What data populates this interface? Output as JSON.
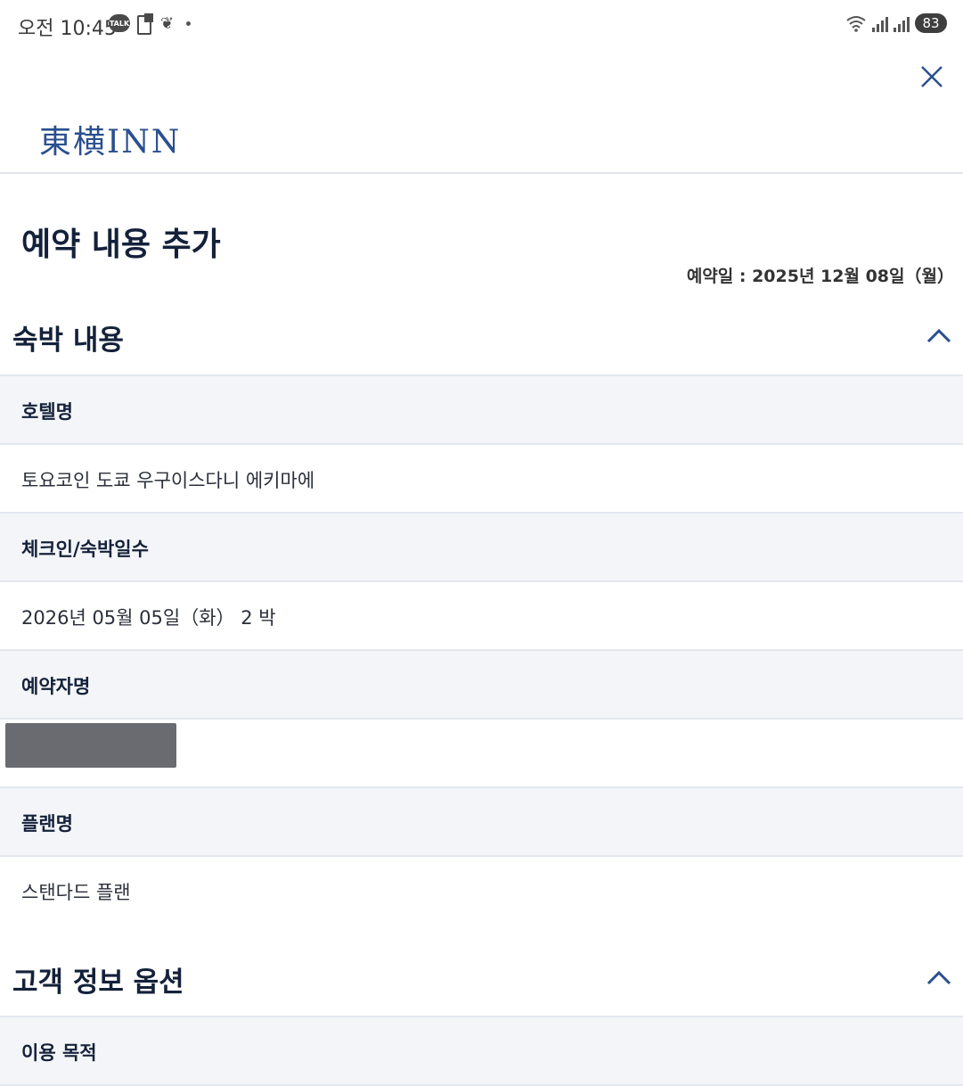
{
  "status_bar": {
    "time": "오전 10:45",
    "talk_badge": "TALK",
    "battery": "83",
    "icons": [
      "kakaotalk-icon",
      "document-icon",
      "butterfly-icon",
      "wifi-icon",
      "signal-icon",
      "battery-icon"
    ]
  },
  "header": {
    "logo": "東横INN",
    "close_icon": "close-icon"
  },
  "page": {
    "title": "예약 내용 추가",
    "booking_date": "예약일 : 2025년 12월 08일（월）"
  },
  "stay_section": {
    "title": "숙박 내용",
    "rows": [
      {
        "label": "호텔명",
        "value": "토요코인 도쿄 우구이스다니 에키마에"
      },
      {
        "label": "체크인/숙박일수",
        "value": "2026년 05월 05일（화） 2 박"
      },
      {
        "label": "예약자명",
        "value": ""
      },
      {
        "label": "플랜명",
        "value": "스탠다드 플랜"
      }
    ]
  },
  "customer_section": {
    "title": "고객 정보 옵션",
    "rows": [
      {
        "label": "이용 목적"
      }
    ]
  },
  "colors": {
    "accent": "#2a4f8f",
    "label_bg": "#f4f5f8",
    "divider": "#e3e8ef"
  }
}
